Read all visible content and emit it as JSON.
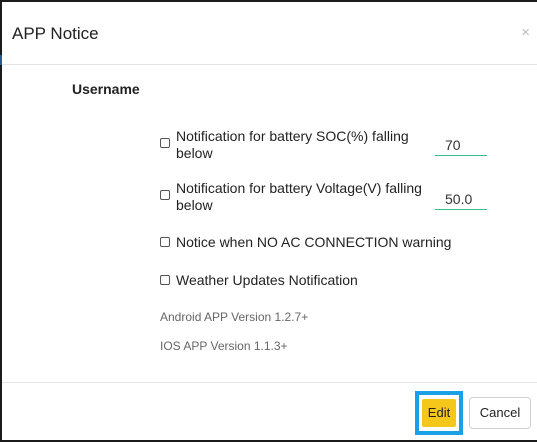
{
  "dialog": {
    "title": "APP Notice",
    "close_symbol": "×"
  },
  "user": {
    "label": "Username"
  },
  "options": [
    {
      "label_line1": "Notification for battery SOC(%) falling",
      "label_line2": "below",
      "value": "70",
      "checked": false
    },
    {
      "label_line1": "Notification for battery Voltage(V) falling",
      "label_line2": "below",
      "value": "50.0",
      "checked": false
    },
    {
      "label": "Notice when NO AC CONNECTION warning",
      "checked": false
    },
    {
      "label": "Weather Updates Notification",
      "checked": false
    }
  ],
  "versions": {
    "android": "Android APP Version 1.2.7+",
    "ios": "IOS APP Version 1.1.3+"
  },
  "footer": {
    "edit_label": "Edit",
    "cancel_label": "Cancel"
  },
  "colors": {
    "edit_button": "#f5c71a",
    "highlight_border": "#1aa0e6",
    "input_underline": "#3bbf8a"
  }
}
